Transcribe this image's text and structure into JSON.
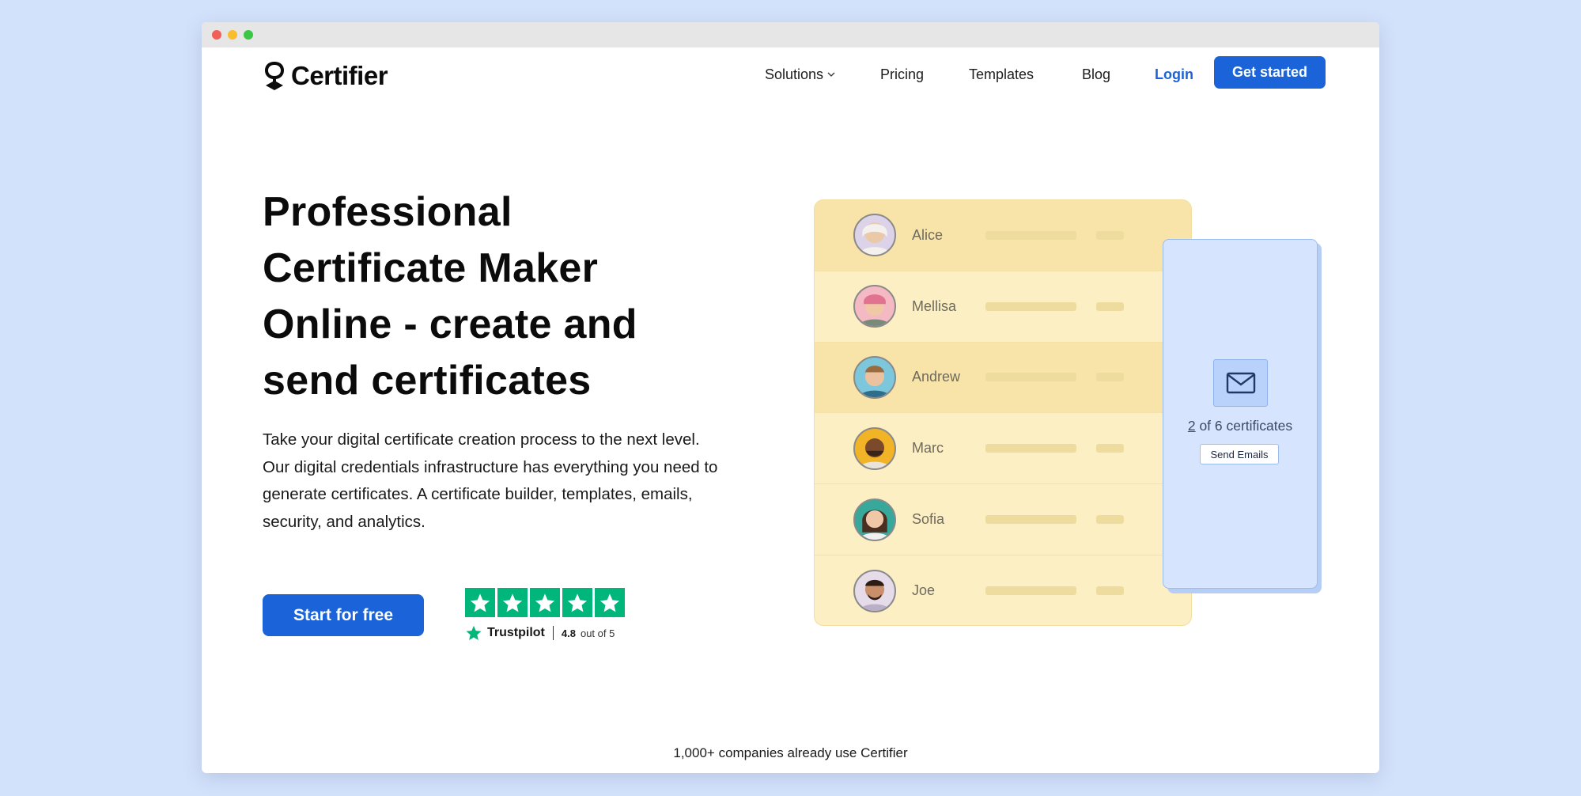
{
  "window": {
    "controls": [
      "close",
      "minimize",
      "maximize"
    ]
  },
  "nav": {
    "logo_text": "Certifier",
    "solutions": "Solutions",
    "pricing": "Pricing",
    "templates": "Templates",
    "blog": "Blog",
    "login": "Login",
    "get_started": "Get started"
  },
  "hero": {
    "headline_lines": [
      "Professional",
      "Certificate Maker",
      "Online - create and",
      "send certificates"
    ],
    "paragraph": "Take your digital certificate creation process to the next level. Our digital credentials infrastructure has everything you need to generate certificates. A certificate builder, templates, emails, security, and analytics.",
    "cta": "Start for free"
  },
  "trustpilot": {
    "brand": "Trustpilot",
    "score": "4.8",
    "out_of": "out of 5",
    "stars": 5
  },
  "recipients": [
    {
      "name": "Alice",
      "highlighted": true
    },
    {
      "name": "Mellisa",
      "highlighted": false
    },
    {
      "name": "Andrew",
      "highlighted": true
    },
    {
      "name": "Marc",
      "highlighted": false
    },
    {
      "name": "Sofia",
      "highlighted": false
    },
    {
      "name": "Joe",
      "highlighted": false
    }
  ],
  "email_panel": {
    "current": "2",
    "count_suffix": " of 6 certificates",
    "send_button": "Send Emails"
  },
  "footer": {
    "companies": "1,000+ companies already use Certifier"
  },
  "colors": {
    "accent": "#1a63d8",
    "background": "#d3e2fb",
    "trustpilot_green": "#00b67a",
    "list_bg": "#fcefc3",
    "email_bg": "#d6e5fd"
  }
}
